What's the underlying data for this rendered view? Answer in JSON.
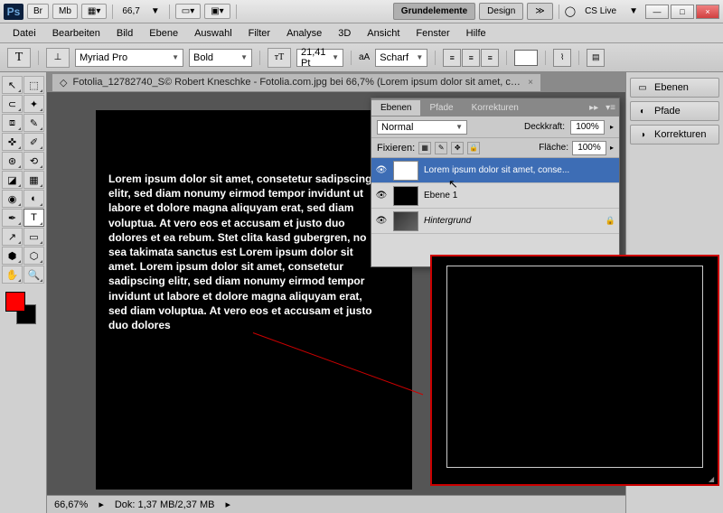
{
  "titlebar": {
    "br": "Br",
    "mb": "Mb",
    "zoom": "66,7",
    "arrow": "▼",
    "ws_active": "Grundelemente",
    "ws_design": "Design",
    "more": "≫",
    "cslive": "CS Live",
    "drop": "▼",
    "min": "—",
    "max": "□",
    "close": "×"
  },
  "menu": [
    "Datei",
    "Bearbeiten",
    "Bild",
    "Ebene",
    "Auswahl",
    "Filter",
    "Analyse",
    "3D",
    "Ansicht",
    "Fenster",
    "Hilfe"
  ],
  "optbar": {
    "tool": "T",
    "font": "Myriad Pro",
    "weight": "Bold",
    "size": "21,41 Pt",
    "aa_lbl": "aA",
    "aa": "Scharf"
  },
  "doc_tab": "Fotolia_12782740_S© Robert Kneschke - Fotolia.com.jpg bei 66,7% (Lorem ipsum dolor sit amet, cons...",
  "text_body": "Lorem ipsum dolor sit amet, consetetur sadipscing elitr, sed diam nonumy eirmod tempor invidunt ut labore et dolore magna aliquyam erat, sed diam voluptua. At vero eos et accusam et justo duo dolores et ea rebum. Stet clita kasd gubergren, no sea takimata sanctus est Lorem ipsum dolor sit amet. Lorem ipsum dolor sit amet, consetetur sadipscing elitr, sed diam nonumy eirmod tempor invidunt ut labore et dolore magna aliquyam erat, sed diam voluptua. At vero eos et accusam et justo duo dolores",
  "status": {
    "zoom": "66,67%",
    "doc": "Dok: 1,37 MB/2,37 MB"
  },
  "rpanels": [
    {
      "icon": "▭",
      "label": "Ebenen"
    },
    {
      "icon": "◐",
      "label": "Pfade"
    },
    {
      "icon": "◑",
      "label": "Korrekturen"
    }
  ],
  "layers_panel": {
    "tabs": [
      "Ebenen",
      "Pfade",
      "Korrekturen"
    ],
    "blend": "Normal",
    "opacity_lbl": "Deckkraft:",
    "opacity": "100%",
    "fix_lbl": "Fixieren:",
    "fill_lbl": "Fläche:",
    "fill": "100%",
    "items": [
      {
        "name": "Lorem ipsum dolor sit amet, conse...",
        "type": "T",
        "sel": true
      },
      {
        "name": "Ebene 1",
        "type": "black",
        "sel": false
      },
      {
        "name": "Hintergrund",
        "type": "img",
        "sel": false,
        "locked": true
      }
    ]
  }
}
